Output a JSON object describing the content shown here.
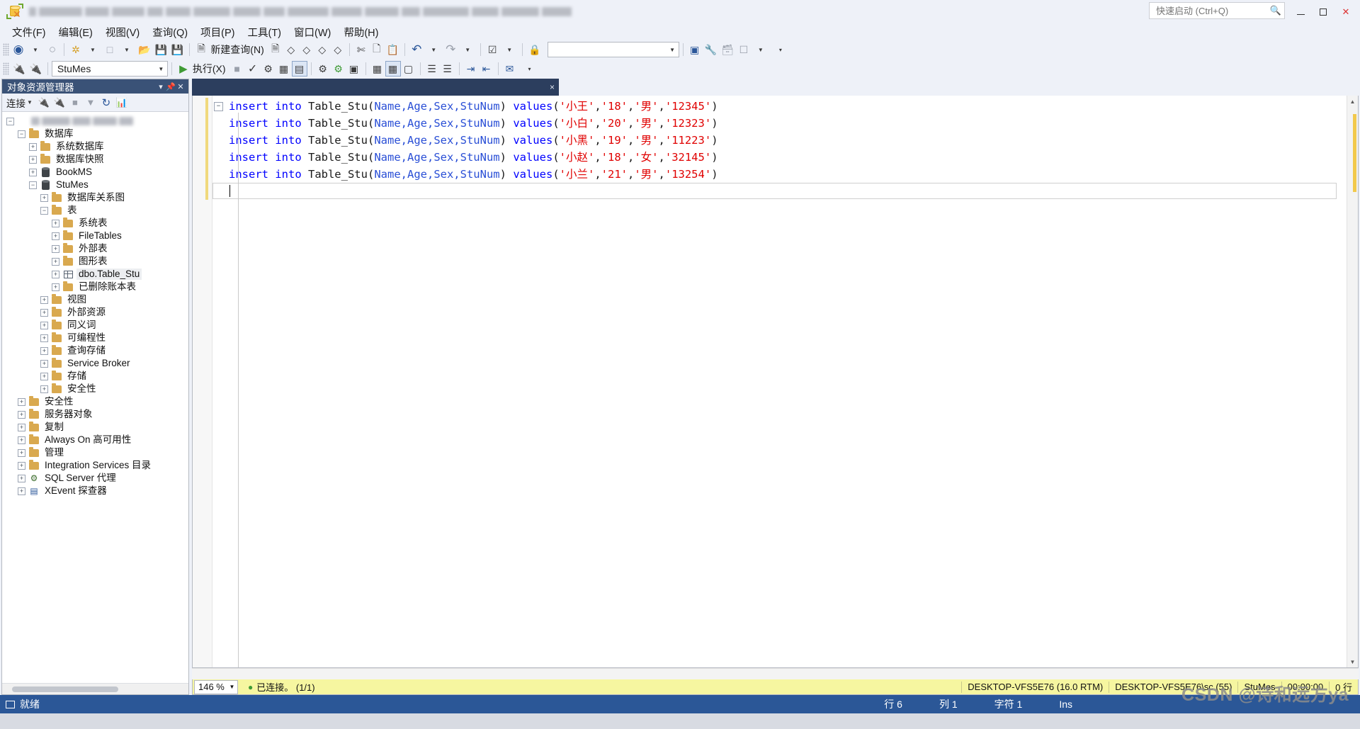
{
  "window": {
    "title_redacted": true,
    "quick_launch_placeholder": "快速启动 (Ctrl+Q)",
    "minimize_label": "最小化",
    "maximize_label": "还原",
    "close_label": "关闭"
  },
  "menubar": {
    "items": [
      {
        "label": "文件(F)"
      },
      {
        "label": "编辑(E)"
      },
      {
        "label": "视图(V)"
      },
      {
        "label": "查询(Q)"
      },
      {
        "label": "项目(P)"
      },
      {
        "label": "工具(T)"
      },
      {
        "label": "窗口(W)"
      },
      {
        "label": "帮助(H)"
      }
    ]
  },
  "toolbar_main": {
    "new_query_label": "新建查询(N)",
    "icons": [
      "navigate-back-icon",
      "navigate-forward-icon",
      "new-project-icon",
      "new-item-icon",
      "open-file-icon",
      "save-icon",
      "save-all-icon",
      "new-query-icon",
      "new-db-query-icon",
      "new-mdx-query-icon",
      "new-dmx-query-icon",
      "new-xmla-query-icon",
      "new-dax-query-icon",
      "cut-icon",
      "copy-icon",
      "paste-icon",
      "undo-icon",
      "redo-icon",
      "checked-box-icon",
      "lock-icon"
    ]
  },
  "toolbar_query": {
    "database_value": "StuMes",
    "execute_label": "执行(X)",
    "icons": [
      "connect-icon",
      "disconnect-icon",
      "parse-icon",
      "display-estimated-plan-icon",
      "query-options-icon",
      "include-actual-plan-icon",
      "include-client-stats-icon",
      "results-to-text-icon",
      "results-to-grid-icon",
      "results-to-file-icon",
      "comment-icon",
      "uncomment-icon",
      "indent-icon",
      "outdent-icon",
      "specify-values-icon"
    ]
  },
  "object_explorer": {
    "title": "对象资源管理器",
    "connect_label": "连接",
    "toolbar_icons": [
      "connect-plug-icon",
      "disconnect-plug-icon",
      "stop-icon",
      "filter-icon",
      "refresh-icon",
      "activity-monitor-icon"
    ],
    "root_redacted": true,
    "tree": [
      {
        "label": "",
        "indent": 0,
        "expander": "minus",
        "icon": "server-icon",
        "redacted": true
      },
      {
        "label": "数据库",
        "indent": 1,
        "expander": "minus",
        "icon": "folder-icon"
      },
      {
        "label": "系统数据库",
        "indent": 2,
        "expander": "plus",
        "icon": "folder-icon"
      },
      {
        "label": "数据库快照",
        "indent": 2,
        "expander": "plus",
        "icon": "folder-icon"
      },
      {
        "label": "BookMS",
        "indent": 2,
        "expander": "plus",
        "icon": "database-icon"
      },
      {
        "label": "StuMes",
        "indent": 2,
        "expander": "minus",
        "icon": "database-icon"
      },
      {
        "label": "数据库关系图",
        "indent": 3,
        "expander": "plus",
        "icon": "folder-icon"
      },
      {
        "label": "表",
        "indent": 3,
        "expander": "minus",
        "icon": "folder-icon"
      },
      {
        "label": "系统表",
        "indent": 4,
        "expander": "plus",
        "icon": "folder-icon"
      },
      {
        "label": "FileTables",
        "indent": 4,
        "expander": "plus",
        "icon": "folder-icon"
      },
      {
        "label": "外部表",
        "indent": 4,
        "expander": "plus",
        "icon": "folder-icon"
      },
      {
        "label": "图形表",
        "indent": 4,
        "expander": "plus",
        "icon": "folder-icon"
      },
      {
        "label": "dbo.Table_Stu",
        "indent": 4,
        "expander": "plus",
        "icon": "table-icon",
        "selected": true
      },
      {
        "label": "已删除账本表",
        "indent": 4,
        "expander": "plus",
        "icon": "folder-icon"
      },
      {
        "label": "视图",
        "indent": 3,
        "expander": "plus",
        "icon": "folder-icon"
      },
      {
        "label": "外部资源",
        "indent": 3,
        "expander": "plus",
        "icon": "folder-icon"
      },
      {
        "label": "同义词",
        "indent": 3,
        "expander": "plus",
        "icon": "folder-icon"
      },
      {
        "label": "可编程性",
        "indent": 3,
        "expander": "plus",
        "icon": "folder-icon"
      },
      {
        "label": "查询存储",
        "indent": 3,
        "expander": "plus",
        "icon": "folder-icon"
      },
      {
        "label": "Service Broker",
        "indent": 3,
        "expander": "plus",
        "icon": "folder-icon"
      },
      {
        "label": "存储",
        "indent": 3,
        "expander": "plus",
        "icon": "folder-icon"
      },
      {
        "label": "安全性",
        "indent": 3,
        "expander": "plus",
        "icon": "folder-icon"
      },
      {
        "label": "安全性",
        "indent": 1,
        "expander": "plus",
        "icon": "folder-icon"
      },
      {
        "label": "服务器对象",
        "indent": 1,
        "expander": "plus",
        "icon": "folder-icon"
      },
      {
        "label": "复制",
        "indent": 1,
        "expander": "plus",
        "icon": "folder-icon"
      },
      {
        "label": "Always On 高可用性",
        "indent": 1,
        "expander": "plus",
        "icon": "folder-icon"
      },
      {
        "label": "管理",
        "indent": 1,
        "expander": "plus",
        "icon": "folder-icon"
      },
      {
        "label": "Integration Services 目录",
        "indent": 1,
        "expander": "plus",
        "icon": "folder-icon"
      },
      {
        "label": "SQL Server 代理",
        "indent": 1,
        "expander": "plus",
        "icon": "agent-icon"
      },
      {
        "label": "XEvent 探查器",
        "indent": 1,
        "expander": "plus",
        "icon": "xevent-icon"
      }
    ]
  },
  "editor": {
    "tab_redacted": true,
    "tab_close_label": "×",
    "lines": [
      {
        "collapser": "minus",
        "tokens": [
          {
            "t": "insert into ",
            "c": "kw"
          },
          {
            "t": "Table_Stu",
            "c": "ident"
          },
          {
            "t": "(",
            "c": "punc"
          },
          {
            "t": "Name,Age,Sex,StuNum",
            "c": "col"
          },
          {
            "t": ") ",
            "c": "punc"
          },
          {
            "t": "values",
            "c": "kw"
          },
          {
            "t": "(",
            "c": "punc"
          },
          {
            "t": "'小王'",
            "c": "str"
          },
          {
            "t": ",",
            "c": "punc"
          },
          {
            "t": "'18'",
            "c": "str"
          },
          {
            "t": ",",
            "c": "punc"
          },
          {
            "t": "'男'",
            "c": "str"
          },
          {
            "t": ",",
            "c": "punc"
          },
          {
            "t": "'12345'",
            "c": "str"
          },
          {
            "t": ")",
            "c": "punc"
          }
        ]
      },
      {
        "collapser": "none",
        "tokens": [
          {
            "t": "insert into ",
            "c": "kw"
          },
          {
            "t": "Table_Stu",
            "c": "ident"
          },
          {
            "t": "(",
            "c": "punc"
          },
          {
            "t": "Name,Age,Sex,StuNum",
            "c": "col"
          },
          {
            "t": ") ",
            "c": "punc"
          },
          {
            "t": "values",
            "c": "kw"
          },
          {
            "t": "(",
            "c": "punc"
          },
          {
            "t": "'小白'",
            "c": "str"
          },
          {
            "t": ",",
            "c": "punc"
          },
          {
            "t": "'20'",
            "c": "str"
          },
          {
            "t": ",",
            "c": "punc"
          },
          {
            "t": "'男'",
            "c": "str"
          },
          {
            "t": ",",
            "c": "punc"
          },
          {
            "t": "'12323'",
            "c": "str"
          },
          {
            "t": ")",
            "c": "punc"
          }
        ]
      },
      {
        "collapser": "none",
        "tokens": [
          {
            "t": "insert into ",
            "c": "kw"
          },
          {
            "t": "Table_Stu",
            "c": "ident"
          },
          {
            "t": "(",
            "c": "punc"
          },
          {
            "t": "Name,Age,Sex,StuNum",
            "c": "col"
          },
          {
            "t": ") ",
            "c": "punc"
          },
          {
            "t": "values",
            "c": "kw"
          },
          {
            "t": "(",
            "c": "punc"
          },
          {
            "t": "'小黑'",
            "c": "str"
          },
          {
            "t": ",",
            "c": "punc"
          },
          {
            "t": "'19'",
            "c": "str"
          },
          {
            "t": ",",
            "c": "punc"
          },
          {
            "t": "'男'",
            "c": "str"
          },
          {
            "t": ",",
            "c": "punc"
          },
          {
            "t": "'11223'",
            "c": "str"
          },
          {
            "t": ")",
            "c": "punc"
          }
        ]
      },
      {
        "collapser": "none",
        "tokens": [
          {
            "t": "insert into ",
            "c": "kw"
          },
          {
            "t": "Table_Stu",
            "c": "ident"
          },
          {
            "t": "(",
            "c": "punc"
          },
          {
            "t": "Name,Age,Sex,StuNum",
            "c": "col"
          },
          {
            "t": ") ",
            "c": "punc"
          },
          {
            "t": "values",
            "c": "kw"
          },
          {
            "t": "(",
            "c": "punc"
          },
          {
            "t": "'小赵'",
            "c": "str"
          },
          {
            "t": ",",
            "c": "punc"
          },
          {
            "t": "'18'",
            "c": "str"
          },
          {
            "t": ",",
            "c": "punc"
          },
          {
            "t": "'女'",
            "c": "str"
          },
          {
            "t": ",",
            "c": "punc"
          },
          {
            "t": "'32145'",
            "c": "str"
          },
          {
            "t": ")",
            "c": "punc"
          }
        ]
      },
      {
        "collapser": "none",
        "tokens": [
          {
            "t": "insert into ",
            "c": "kw"
          },
          {
            "t": "Table_Stu",
            "c": "ident"
          },
          {
            "t": "(",
            "c": "punc"
          },
          {
            "t": "Name,Age,Sex,StuNum",
            "c": "col"
          },
          {
            "t": ") ",
            "c": "punc"
          },
          {
            "t": "values",
            "c": "kw"
          },
          {
            "t": "(",
            "c": "punc"
          },
          {
            "t": "'小兰'",
            "c": "str"
          },
          {
            "t": ",",
            "c": "punc"
          },
          {
            "t": "'21'",
            "c": "str"
          },
          {
            "t": ",",
            "c": "punc"
          },
          {
            "t": "'男'",
            "c": "str"
          },
          {
            "t": ",",
            "c": "punc"
          },
          {
            "t": "'13254'",
            "c": "str"
          },
          {
            "t": ")",
            "c": "punc"
          }
        ]
      }
    ]
  },
  "editor_status": {
    "zoom": "146 %",
    "connection": "已连接。 (1/1)",
    "server": "DESKTOP-VFS5E76 (16.0 RTM)",
    "user": "DESKTOP-VFS5E76\\sc (55)",
    "database": "StuMes",
    "elapsed": "00:00:00",
    "rows": "0 行"
  },
  "statusbar": {
    "ready": "就绪",
    "line": "行 6",
    "column": "列 1",
    "chars": "字符 1",
    "insert_mode": "Ins"
  },
  "watermark": "CSDN @诗和远方ya",
  "colors": {
    "titlebar_bg": "#eef1f8",
    "statusbar_bg": "#2b5797",
    "editor_status_bg": "#f6f6a0",
    "oe_title_bg": "#3a5277",
    "tab_bg": "#2c3e5e",
    "keyword": "#0000ff",
    "string": "#e00000",
    "column": "#2a4fd6"
  }
}
